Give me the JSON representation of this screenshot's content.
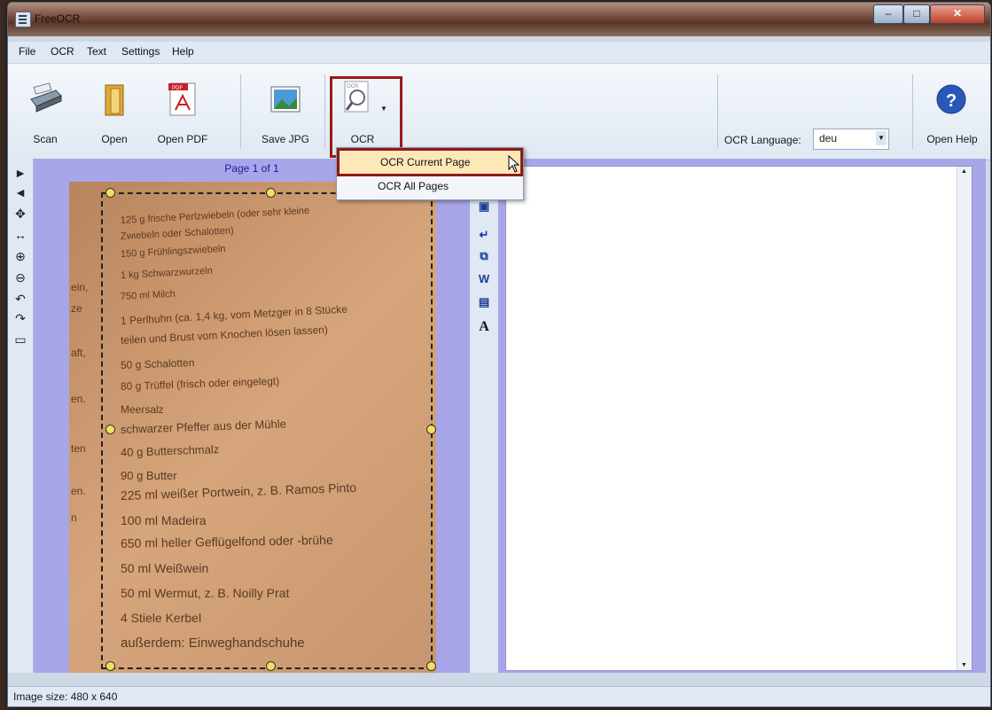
{
  "window": {
    "title": "FreeOCR"
  },
  "menu": [
    "File",
    "OCR",
    "Text",
    "Settings",
    "Help"
  ],
  "toolbar": {
    "scan_label": "Scan",
    "open_label": "Open",
    "openpdf_label": "Open PDF",
    "savejpg_label": "Save JPG",
    "ocr_label": "OCR",
    "lang_label": "OCR Language:",
    "lang_value": "deu",
    "help_label": "Open Help"
  },
  "ocr_menu": [
    "OCR Current Page",
    "OCR All Pages"
  ],
  "page": {
    "label": "Page 1 of 1"
  },
  "scan_text": [
    "125 g frische Perlzwiebeln (oder sehr kleine",
    "Zwiebeln oder Schalotten)",
    "150 g Frühlingszwiebeln",
    "1 kg Schwarzwurzeln",
    "750 ml Milch",
    "1 Perlhuhn (ca. 1,4 kg, vom Metzger in 8 Stücke",
    "teilen und Brust vom Knochen lösen lassen)",
    "50 g Schalotten",
    "80 g Trüffel (frisch oder eingelegt)",
    "Meersalz",
    "schwarzer Pfeffer aus der Mühle",
    "40 g Butterschmalz",
    "90 g Butter",
    "225 ml weißer Portwein, z. B. Ramos Pinto",
    "100 ml Madeira",
    "650 ml heller Geflügelfond oder -brühe",
    "50 ml Weißwein",
    "50 ml Wermut, z. B. Noilly Prat",
    "4 Stiele Kerbel",
    "außerdem: Einweghandschuhe"
  ],
  "scan_margin": [
    "ein,",
    "ze",
    "aft,",
    "en.",
    "ten",
    "en.",
    "n"
  ],
  "status": {
    "text": "Image size: 480 x 640"
  }
}
